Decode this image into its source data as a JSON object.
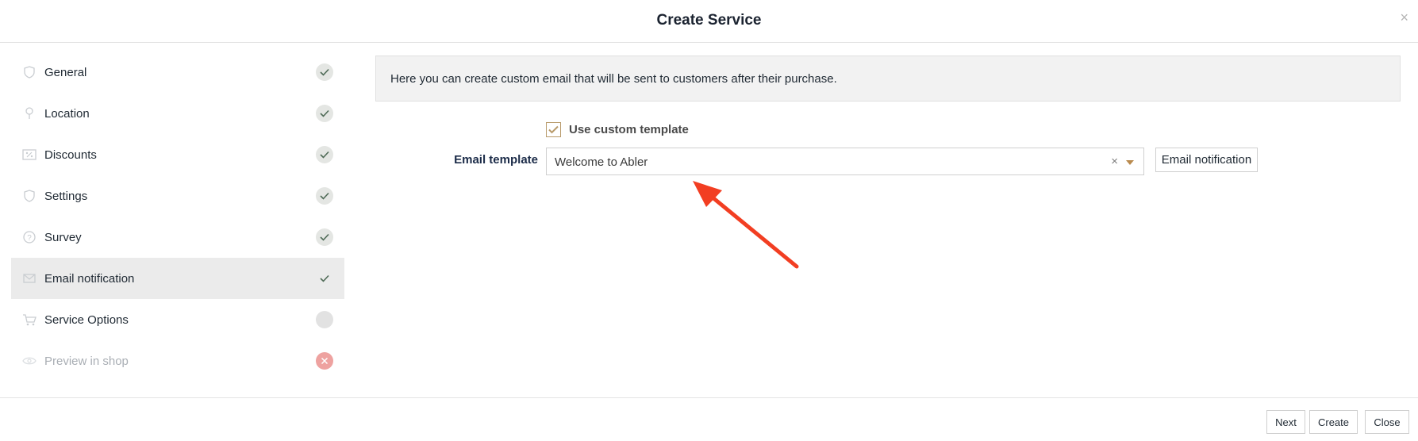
{
  "modal": {
    "title": "Create Service",
    "close_label": "×"
  },
  "sidebar": {
    "items": [
      {
        "label": "General",
        "icon": "shield-icon",
        "status": "done"
      },
      {
        "label": "Location",
        "icon": "pin-icon",
        "status": "done"
      },
      {
        "label": "Discounts",
        "icon": "percent-icon",
        "status": "done"
      },
      {
        "label": "Settings",
        "icon": "shield-icon",
        "status": "done"
      },
      {
        "label": "Survey",
        "icon": "question-icon",
        "status": "done"
      },
      {
        "label": "Email notification",
        "icon": "envelope-icon",
        "status": "done",
        "active": true
      },
      {
        "label": "Service Options",
        "icon": "cart-icon",
        "status": "pending"
      },
      {
        "label": "Preview in shop",
        "icon": "eye-icon",
        "status": "error",
        "disabled": true
      }
    ]
  },
  "content": {
    "info_text": "Here you can create custom email that will be sent to customers after their purchase.",
    "use_custom_template": {
      "label": "Use custom template",
      "checked": true
    },
    "email_template": {
      "label": "Email template",
      "value": "Welcome to Abler",
      "clear_label": "×",
      "side_button_label": "Email notification"
    }
  },
  "footer": {
    "next_label": "Next",
    "create_label": "Create",
    "close_label": "Close"
  },
  "colors": {
    "accent": "#b89a6a",
    "annotation_arrow": "#f23e22",
    "check": "#4f6b57"
  }
}
